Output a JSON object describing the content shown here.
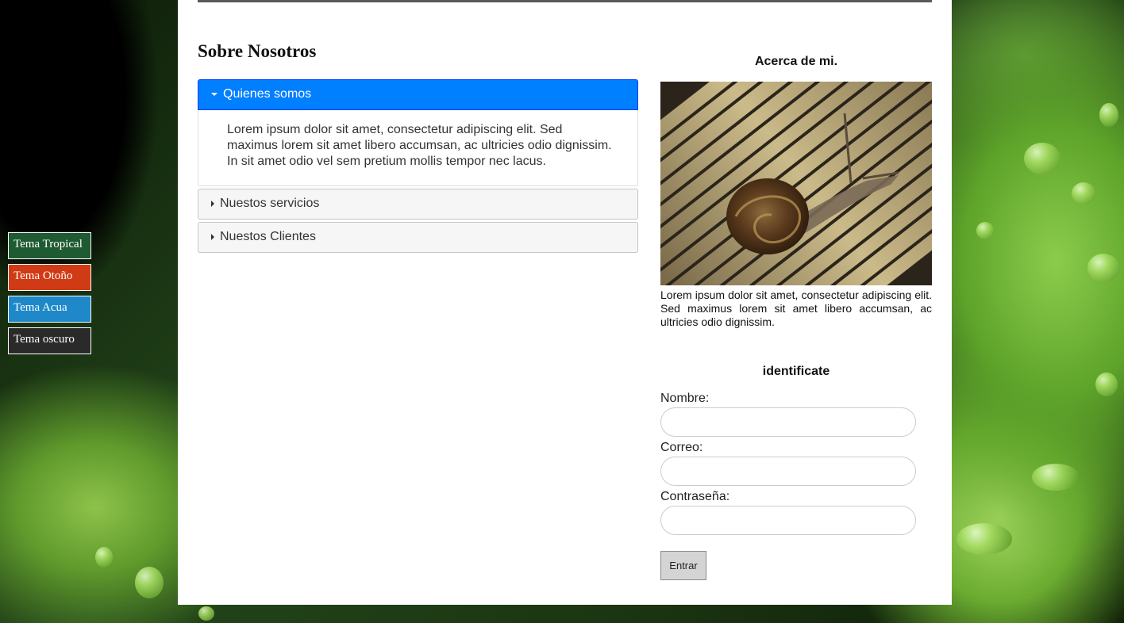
{
  "themes": [
    {
      "label": "Tema Tropical",
      "color": "#1e5a32"
    },
    {
      "label": "Tema Otoño",
      "color": "#d03a14"
    },
    {
      "label": "Tema Acua",
      "color": "#1e88c8"
    },
    {
      "label": "Tema oscuro",
      "color": "#2a2a2a"
    }
  ],
  "main": {
    "title": "Sobre Nosotros",
    "accordion": [
      {
        "label": "Quienes somos",
        "expanded": true,
        "content": "Lorem ipsum dolor sit amet, consectetur adipiscing elit. Sed maximus lorem sit amet libero accumsan, ac ultricies odio dignissim. In sit amet odio vel sem pretium mollis tempor nec lacus."
      },
      {
        "label": "Nuestos servicios",
        "expanded": false
      },
      {
        "label": "Nuestos Clientes",
        "expanded": false
      }
    ]
  },
  "sidebar": {
    "about_title": "Acerca de mi.",
    "photo_subject": "snail on bamboo sticks",
    "caption": "Lorem ipsum dolor sit amet, consectetur adipiscing elit. Sed maximus lorem sit amet libero accumsan, ac ultricies odio dignissim.",
    "login": {
      "title": "identificate",
      "name_label": "Nombre:",
      "email_label": "Correo:",
      "password_label": "Contraseña:",
      "name_value": "",
      "email_value": "",
      "password_value": "",
      "submit_label": "Entrar"
    }
  },
  "colors": {
    "accordion_active": "#007fff",
    "panel_background": "#ffffff"
  }
}
